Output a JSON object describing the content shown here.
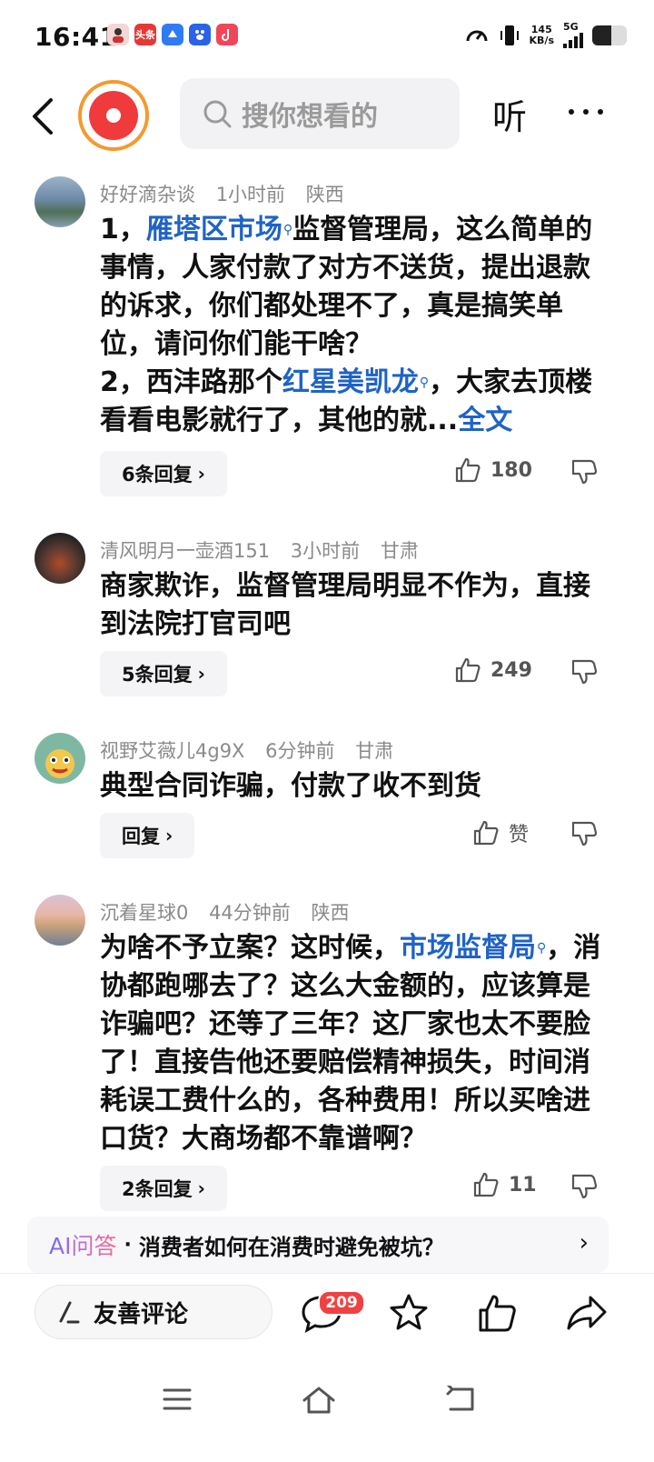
{
  "status_bar": {
    "time": "16:41",
    "notification_apps": [
      "avatar-app",
      "头条",
      "blue-app",
      "baidu-app",
      "douyin-app"
    ],
    "net_speed_value": "145",
    "net_speed_unit": "KB/s",
    "network": "5G",
    "battery_level": 0.55
  },
  "header": {
    "search_placeholder": "搜你想看的",
    "listen_label": "听"
  },
  "comments": [
    {
      "user": "好好滴杂谈",
      "time": "1小时前",
      "location": "陕西",
      "body_parts": [
        {
          "text": "1，",
          "link": false
        },
        {
          "text": "雁塔区市场",
          "link": true
        },
        {
          "text": "监督管理局，这么简单的事情，人家付款了对方不送货，提出退款的诉求，你们都处理不了，真是搞笑单位，请问你们能干啥？",
          "link": false
        },
        {
          "text": "2，西沣路那个",
          "link": false
        },
        {
          "text": "红星美凯龙",
          "link": true
        },
        {
          "text": "，大家去顶楼看看电影就行了，其他的就...",
          "link": false
        },
        {
          "text": "全文",
          "link": true
        }
      ],
      "reply_label": "6条回复",
      "likes": "180"
    },
    {
      "user": "清风明月一壶酒151",
      "time": "3小时前",
      "location": "甘肃",
      "body": "商家欺诈，监督管理局明显不作为，直接到法院打官司吧",
      "reply_label": "5条回复",
      "likes": "249"
    },
    {
      "user": "视野艾薇儿4g9X",
      "time": "6分钟前",
      "location": "甘肃",
      "body": "典型合同诈骗，付款了收不到货",
      "reply_label": "回复",
      "likes": "赞"
    },
    {
      "user": "沉着星球0",
      "time": "44分钟前",
      "location": "陕西",
      "body_parts": [
        {
          "text": "为啥不予立案？这时候，",
          "link": false
        },
        {
          "text": "市场监督局",
          "link": true
        },
        {
          "text": "，消协都跑哪去了？这么大金额的，应该算是诈骗吧？还等了三年？这厂家也太不要脸了！直接告他还要赔偿精神损失，时间消耗误工费什么的，各种费用！所以买啥进口货？大商场都不靠谱啊？",
          "link": false
        }
      ],
      "reply_label": "2条回复",
      "likes": "11"
    }
  ],
  "ai_bar": {
    "label": "AI问答",
    "separator": "·",
    "question": "消费者如何在消费时避免被坑？"
  },
  "toolbar": {
    "comment_placeholder": "友善评论",
    "comment_count": "209"
  },
  "colors": {
    "link": "#1f63c6",
    "badge": "#f04142",
    "logo_red": "#ef3b3b",
    "logo_ring": "#f39a2e"
  }
}
